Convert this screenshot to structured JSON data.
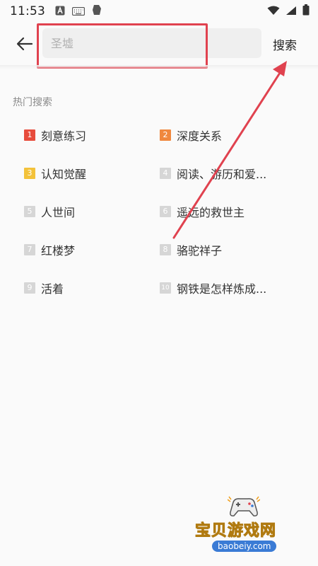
{
  "status_bar": {
    "time": "11:53"
  },
  "search": {
    "placeholder": "圣墟",
    "value": "",
    "button_label": "搜索"
  },
  "hot_searches": {
    "title": "热门搜索",
    "items": [
      {
        "rank": "1",
        "label": "刻意练习"
      },
      {
        "rank": "2",
        "label": "深度关系"
      },
      {
        "rank": "3",
        "label": "认知觉醒"
      },
      {
        "rank": "4",
        "label": "阅读、游历和爱..."
      },
      {
        "rank": "5",
        "label": "人世间"
      },
      {
        "rank": "6",
        "label": "遥远的救世主"
      },
      {
        "rank": "7",
        "label": "红楼梦"
      },
      {
        "rank": "8",
        "label": "骆驼祥子"
      },
      {
        "rank": "9",
        "label": "活着"
      },
      {
        "rank": "10",
        "label": "钢铁是怎样炼成..."
      }
    ]
  },
  "watermark": {
    "title": "宝贝游戏网",
    "site": "baobeiy.com"
  },
  "colors": {
    "annotation": "#e0424f",
    "rank_1": "#e74c3c",
    "rank_2": "#f0883e",
    "rank_3": "#f3c23a",
    "rank_other": "#d6d6d6"
  }
}
